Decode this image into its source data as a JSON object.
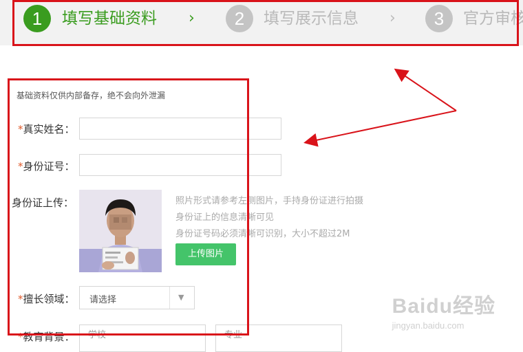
{
  "steps": [
    {
      "num": "1",
      "label": "填写基础资料"
    },
    {
      "num": "2",
      "label": "填写展示信息"
    },
    {
      "num": "3",
      "label": "官方审核"
    }
  ],
  "chevron": "›",
  "form": {
    "note": "基础资料仅供内部备存，绝不会向外泄漏",
    "required_mark": "*",
    "name_label": "真实姓名：",
    "id_label": "身份证号：",
    "upload_label": "身份证上传：",
    "upload_hints": [
      "照片形式请参考左侧图片，手持身份证进行拍摄",
      "身份证上的信息清晰可见",
      "身份证号码必须清晰可识别，大小不超过2M"
    ],
    "upload_button": "上传图片",
    "domain_label": "擅长领域：",
    "domain_select_value": "请选择",
    "edu_label": "教育背景：",
    "school_placeholder": "学校",
    "major_placeholder": "专业"
  },
  "watermark": {
    "main": "Baidu经验",
    "sub": "jingyan.baidu.com"
  },
  "colors": {
    "accent": "#3a9c1f",
    "highlight": "#d9131a",
    "button": "#44c46a"
  },
  "icons": [
    "chevron-right-icon",
    "dropdown-caret-icon",
    "annotation-arrow-icon"
  ]
}
